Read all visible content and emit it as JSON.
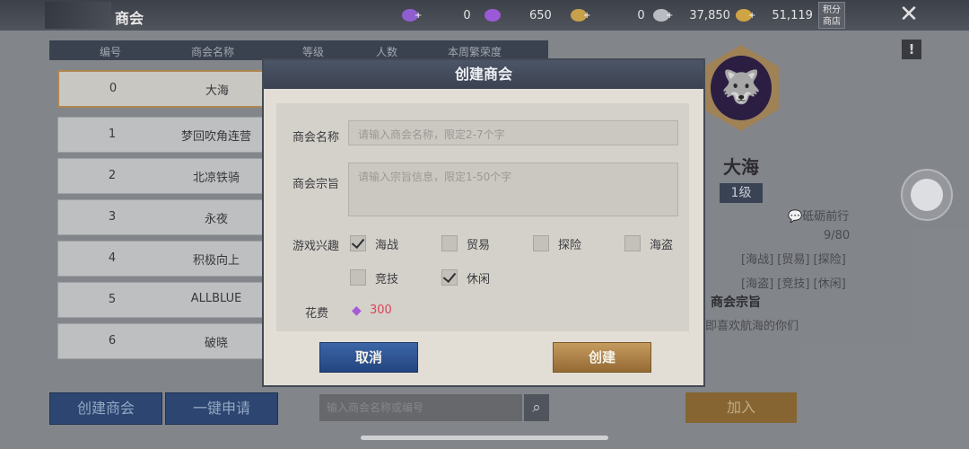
{
  "topbar": {
    "title": "商会",
    "resources": [
      {
        "icon": "purple-gem-plus-icon",
        "value": "0",
        "color": "#8f5fd0"
      },
      {
        "icon": "purple-gem-bundle-icon",
        "value": "650",
        "color": "#9a5ad6"
      },
      {
        "icon": "gold-coin-plus-icon",
        "value": "0",
        "color": "#c8a04b"
      },
      {
        "icon": "silver-coin-plus-icon",
        "value": "37,850",
        "color": "#b9bcc2"
      },
      {
        "icon": "gold-ingot-plus-icon",
        "value": "51,119",
        "color": "#d0a445"
      }
    ],
    "shop_label": "积分商店"
  },
  "list": {
    "headers": [
      "编号",
      "商会名称",
      "等级",
      "人数",
      "本周繁荣度"
    ],
    "rows": [
      {
        "idx": "0",
        "name": "大海"
      },
      {
        "idx": "1",
        "name": "梦回吹角连营"
      },
      {
        "idx": "2",
        "name": "北凉铁骑"
      },
      {
        "idx": "3",
        "name": "永夜"
      },
      {
        "idx": "4",
        "name": "积极向上"
      },
      {
        "idx": "5",
        "name": "ALLBLUE"
      },
      {
        "idx": "6",
        "name": "破晓"
      }
    ]
  },
  "bottom": {
    "create_label": "创建商会",
    "apply_label": "一键申请",
    "search_placeholder": "输入商会名称或编号",
    "join_label": "加入"
  },
  "detail": {
    "name": "大海",
    "level": "1级",
    "leader": "砥砺前行",
    "members": "9/80",
    "tags_line1": "[海战] [贸易] [探险]",
    "tags_line2": "[海盗] [竞技] [休闲]",
    "purpose_title": "商会宗旨",
    "purpose_text": "即喜欢航海的你们"
  },
  "modal": {
    "title": "创建商会",
    "name_label": "商会名称",
    "name_placeholder": "请输入商会名称，限定2-7个字",
    "purpose_label": "商会宗旨",
    "purpose_placeholder": "请输入宗旨信息，限定1-50个字",
    "interest_label": "游戏兴趣",
    "interests": [
      {
        "label": "海战",
        "checked": true
      },
      {
        "label": "贸易",
        "checked": false
      },
      {
        "label": "探险",
        "checked": false
      },
      {
        "label": "海盗",
        "checked": false
      },
      {
        "label": "竞技",
        "checked": false
      },
      {
        "label": "休闲",
        "checked": true
      }
    ],
    "cost_label": "花费",
    "cost_value": "300",
    "cancel_label": "取消",
    "create_label": "创建"
  }
}
